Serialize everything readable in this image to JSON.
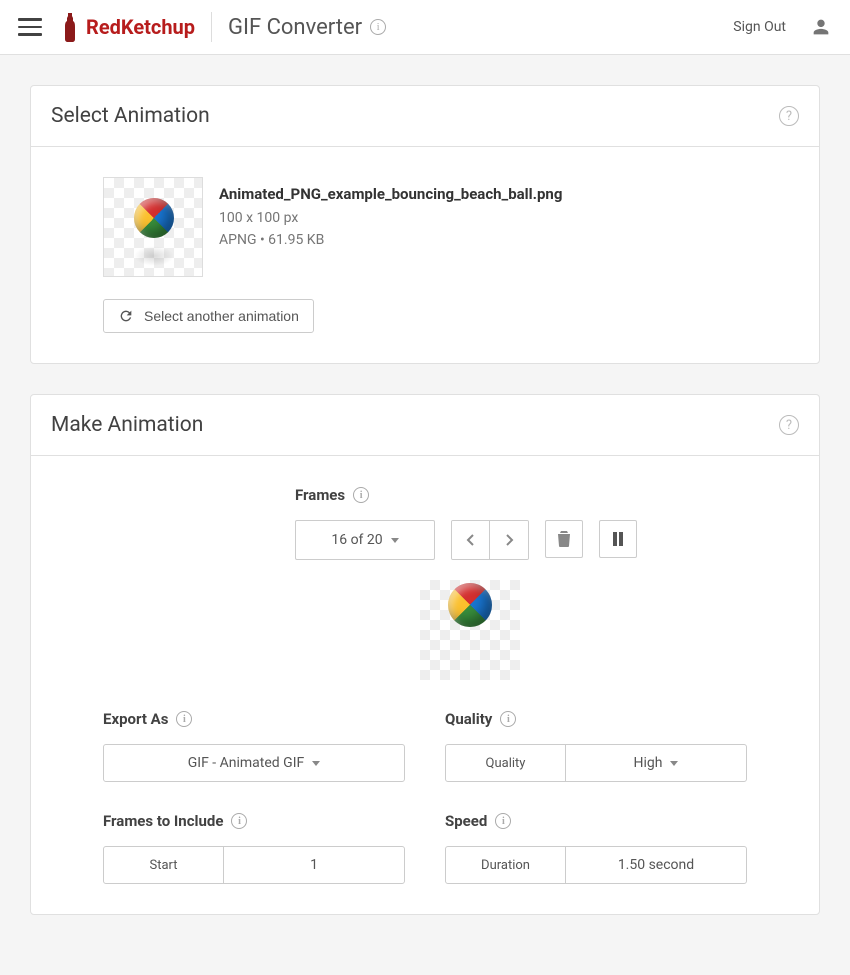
{
  "header": {
    "brand": "RedKetchup",
    "page_title": "GIF Converter",
    "sign_out": "Sign Out"
  },
  "select_card": {
    "title": "Select Animation",
    "file_name": "Animated_PNG_example_bouncing_beach_ball.png",
    "dimensions": "100 x 100 px",
    "format_size": "APNG • 61.95 KB",
    "select_another": "Select another animation"
  },
  "make_card": {
    "title": "Make Animation",
    "frames_label": "Frames",
    "frame_counter": "16 of 20",
    "export_as_label": "Export As",
    "export_as_value": "GIF - Animated GIF",
    "quality_label": "Quality",
    "quality_field_label": "Quality",
    "quality_value": "High",
    "frames_include_label": "Frames to Include",
    "start_label": "Start",
    "start_value": "1",
    "speed_label": "Speed",
    "duration_label": "Duration",
    "duration_value": "1.50 second"
  }
}
